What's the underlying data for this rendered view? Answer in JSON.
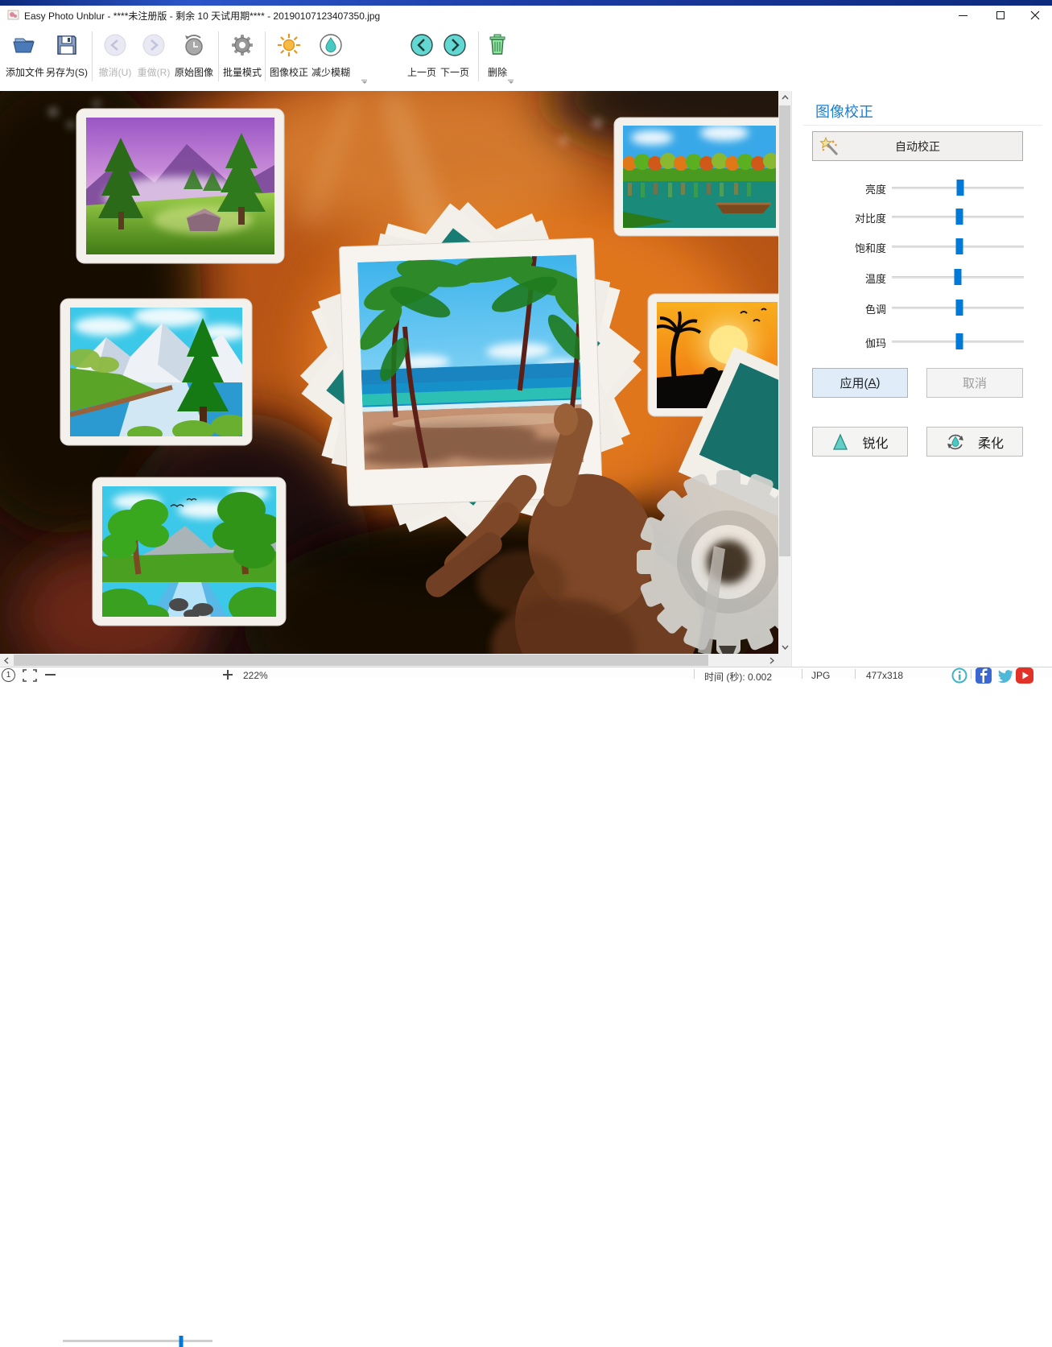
{
  "window": {
    "title": "Easy Photo Unblur - ****未注册版 - 剩余 10 天试用期**** - 20190107123407350.jpg"
  },
  "toolbar": {
    "items": [
      {
        "label": "添加文件",
        "icon": "open-folder-icon",
        "enabled": true
      },
      {
        "label": "另存为(S)",
        "icon": "save-floppy-icon",
        "enabled": true
      },
      {
        "label": "撤消(U)",
        "icon": "undo-arrow-icon",
        "enabled": false
      },
      {
        "label": "重做(R)",
        "icon": "redo-arrow-icon",
        "enabled": false
      },
      {
        "label": "原始图像",
        "icon": "history-clock-icon",
        "enabled": true
      },
      {
        "label": "批量模式",
        "icon": "gear-icon",
        "enabled": true
      },
      {
        "label": "图像校正",
        "icon": "sun-icon",
        "enabled": true
      },
      {
        "label": "减少模糊",
        "icon": "droplet-circle-icon",
        "enabled": true
      },
      {
        "label": "上一页",
        "icon": "prev-circle-icon",
        "enabled": true
      },
      {
        "label": "下一页",
        "icon": "next-circle-icon",
        "enabled": true
      },
      {
        "label": "删除",
        "icon": "trash-icon",
        "enabled": true
      }
    ]
  },
  "panel": {
    "title": "图像校正",
    "auto_correct_label": "自动校正",
    "sliders": [
      {
        "label": "亮度",
        "value_pct": 52
      },
      {
        "label": "对比度",
        "value_pct": 51
      },
      {
        "label": "饱和度",
        "value_pct": 51
      },
      {
        "label": "温度",
        "value_pct": 50
      },
      {
        "label": "色调",
        "value_pct": 51
      },
      {
        "label": "伽玛",
        "value_pct": 51
      }
    ],
    "apply": {
      "prefix": "应用(",
      "key": "A",
      "suffix": ")"
    },
    "cancel_label": "取消",
    "sharpen_label": "锐化",
    "soften_label": "柔化",
    "accent_blue": "#0079d7",
    "title_blue": "#1f7ec8"
  },
  "statusbar": {
    "actual_size_glyph": "1",
    "zoom_value": "222%",
    "zoom_slider_pct": 79,
    "time_label": "时间 (秒): 0.002",
    "format": "JPG",
    "resolution": "477x318"
  }
}
